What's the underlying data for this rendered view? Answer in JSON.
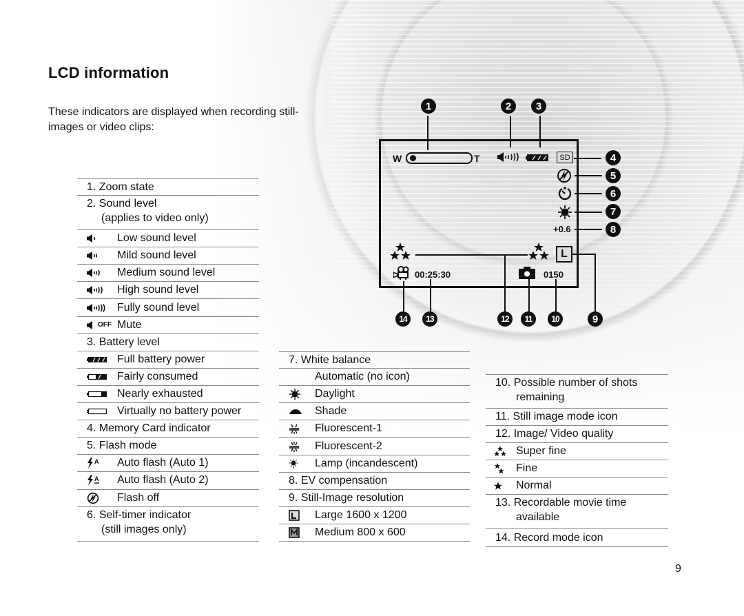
{
  "page": {
    "title": "LCD information",
    "intro": "These indicators are displayed when recording still-images or video clips:",
    "page_number": "9"
  },
  "lcd_diagram": {
    "zoom_wide_label": "W",
    "zoom_tele_label": "T",
    "memory_card_label": "SD",
    "ev_value": "+0.6",
    "movie_time": "00:25:30",
    "shots_remaining": "0150",
    "resolution_label": "L",
    "callouts": [
      "1",
      "2",
      "3",
      "4",
      "5",
      "6",
      "7",
      "8",
      "9",
      "10",
      "11",
      "12",
      "13",
      "14"
    ]
  },
  "legend_left": [
    {
      "type": "header",
      "text": "1. Zoom state"
    },
    {
      "type": "header2",
      "text": "2. Sound level",
      "cont": "(applies to video only)"
    },
    {
      "type": "item",
      "icon": "speaker-low-icon",
      "text": "Low sound level"
    },
    {
      "type": "item",
      "icon": "speaker-mild-icon",
      "text": "Mild sound level"
    },
    {
      "type": "item",
      "icon": "speaker-medium-icon",
      "text": "Medium sound level"
    },
    {
      "type": "item",
      "icon": "speaker-high-icon",
      "text": "High sound level"
    },
    {
      "type": "item",
      "icon": "speaker-full-icon",
      "text": "Fully sound level"
    },
    {
      "type": "item",
      "icon": "speaker-mute-icon",
      "text": "Mute",
      "icon_text": "OFF"
    },
    {
      "type": "header",
      "text": "3. Battery level"
    },
    {
      "type": "item",
      "icon": "battery-full-icon",
      "text": "Full battery power"
    },
    {
      "type": "item",
      "icon": "battery-fair-icon",
      "text": "Fairly consumed"
    },
    {
      "type": "item",
      "icon": "battery-low-icon",
      "text": "Nearly exhausted"
    },
    {
      "type": "item",
      "icon": "battery-empty-icon",
      "text": "Virtually no battery power"
    },
    {
      "type": "header",
      "text": "4. Memory Card indicator"
    },
    {
      "type": "header",
      "text": "5. Flash mode"
    },
    {
      "type": "item",
      "icon": "flash-auto1-icon",
      "text": "Auto flash (Auto 1)"
    },
    {
      "type": "item",
      "icon": "flash-auto2-icon",
      "text": "Auto flash (Auto 2)"
    },
    {
      "type": "item",
      "icon": "flash-off-icon",
      "text": "Flash off"
    },
    {
      "type": "header2",
      "text": "6. Self-timer indicator",
      "cont": "(still images only)"
    }
  ],
  "legend_middle": [
    {
      "type": "header",
      "text": "7.  White balance"
    },
    {
      "type": "item",
      "icon": "",
      "text": "Automatic (no icon)"
    },
    {
      "type": "item",
      "icon": "daylight-icon",
      "text": "Daylight"
    },
    {
      "type": "item",
      "icon": "shade-icon",
      "text": "Shade"
    },
    {
      "type": "item",
      "icon": "fluorescent1-icon",
      "text": "Fluorescent-1"
    },
    {
      "type": "item",
      "icon": "fluorescent2-icon",
      "text": "Fluorescent-2"
    },
    {
      "type": "item",
      "icon": "lamp-icon",
      "text": "Lamp (incandescent)"
    },
    {
      "type": "header",
      "text": "8. EV compensation"
    },
    {
      "type": "header",
      "text": "9. Still-Image resolution"
    },
    {
      "type": "item",
      "icon": "resolution-large-icon",
      "text": "Large 1600 x 1200",
      "icon_text": "L"
    },
    {
      "type": "item",
      "icon": "resolution-medium-icon",
      "text": "Medium 800 x 600",
      "icon_text": "M"
    }
  ],
  "legend_right": [
    {
      "type": "header2",
      "text": "10. Possible number of shots",
      "cont": "remaining"
    },
    {
      "type": "header",
      "text": "11. Still image mode icon"
    },
    {
      "type": "header",
      "text": "12. Image/ Video quality"
    },
    {
      "type": "item",
      "icon": "quality-superfine-icon",
      "text": "Super fine"
    },
    {
      "type": "item",
      "icon": "quality-fine-icon",
      "text": "Fine"
    },
    {
      "type": "item",
      "icon": "quality-normal-icon",
      "text": "Normal"
    },
    {
      "type": "header2",
      "text": "13. Recordable movie time",
      "cont": "available"
    },
    {
      "type": "header",
      "text": "14. Record mode icon"
    }
  ]
}
